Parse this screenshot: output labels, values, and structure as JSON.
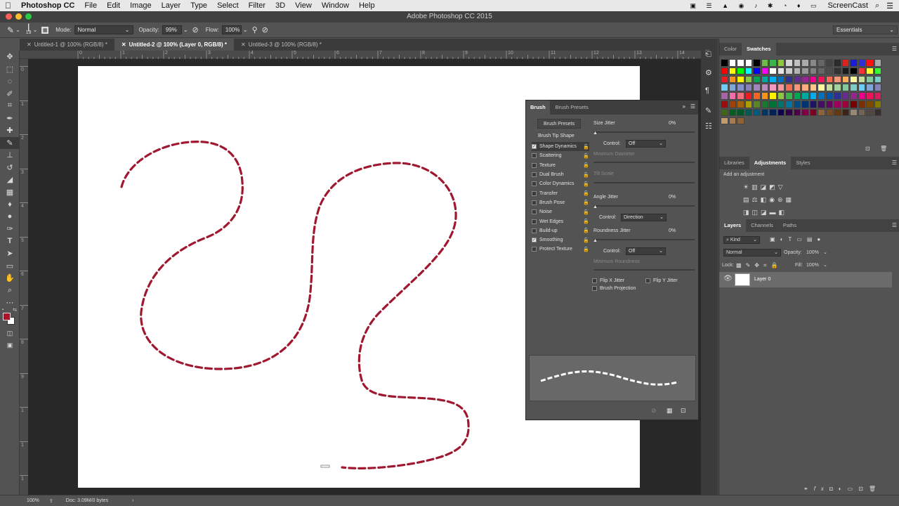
{
  "menubar": {
    "apple": "",
    "app": "Photoshop CC",
    "items": [
      "File",
      "Edit",
      "Image",
      "Layer",
      "Type",
      "Select",
      "Filter",
      "3D",
      "View",
      "Window",
      "Help"
    ],
    "right_app": "ScreenCast"
  },
  "window": {
    "title": "Adobe Photoshop CC 2015"
  },
  "options": {
    "brush_size": "19",
    "mode_label": "Mode:",
    "mode_value": "Normal",
    "opacity_label": "Opacity:",
    "opacity_value": "99%",
    "flow_label": "Flow:",
    "flow_value": "100%",
    "workspace": "Essentials"
  },
  "doc_tabs": [
    {
      "label": "Untitled-1 @ 100% (RGB/8) *",
      "active": false
    },
    {
      "label": "Untitled-2 @ 100% (Layer 0, RGB/8) *",
      "active": true
    },
    {
      "label": "Untitled-3 @ 100% (RGB/8) *",
      "active": false
    }
  ],
  "ruler_top": [
    "0",
    "1",
    "2",
    "3",
    "4",
    "5",
    "6",
    "7",
    "8",
    "9",
    "10",
    "11",
    "12",
    "13",
    "14",
    "15",
    "16"
  ],
  "ruler_left": [
    "0",
    "1",
    "2",
    "3",
    "4",
    "5",
    "6",
    "7",
    "8",
    "9",
    "1",
    "1",
    "1"
  ],
  "brush_panel": {
    "tabs": [
      "Brush",
      "Brush Presets"
    ],
    "presets_button": "Brush Presets",
    "tip_shape": "Brush Tip Shape",
    "items": [
      {
        "label": "Shape Dynamics",
        "checked": true,
        "selected": true
      },
      {
        "label": "Scattering",
        "checked": false
      },
      {
        "label": "Texture",
        "checked": false
      },
      {
        "label": "Dual Brush",
        "checked": false
      },
      {
        "label": "Color Dynamics",
        "checked": false
      },
      {
        "label": "Transfer",
        "checked": false
      },
      {
        "label": "Brush Pose",
        "checked": false
      },
      {
        "label": "Noise",
        "checked": false
      },
      {
        "label": "Wet Edges",
        "checked": false
      },
      {
        "label": "Build-up",
        "checked": false
      },
      {
        "label": "Smoothing",
        "checked": true
      },
      {
        "label": "Protect Texture",
        "checked": false
      }
    ],
    "size_jitter_label": "Size Jitter",
    "size_jitter_value": "0%",
    "control1_label": "Control:",
    "control1_value": "Off",
    "min_diameter": "Minimum Diameter",
    "tilt_scale": "Tilt Scale",
    "angle_jitter_label": "Angle Jitter",
    "angle_jitter_value": "0%",
    "control2_label": "Control:",
    "control2_value": "Direction",
    "roundness_label": "Roundness Jitter",
    "roundness_value": "0%",
    "control3_label": "Control:",
    "control3_value": "Off",
    "min_roundness": "Minimum Roundness",
    "flip_x": "Flip X Jitter",
    "flip_y": "Flip Y Jitter",
    "projection": "Brush Projection"
  },
  "color_panel": {
    "tabs": [
      "Color",
      "Swatches"
    ],
    "active": "Swatches"
  },
  "adjust_panel": {
    "tabs": [
      "Libraries",
      "Adjustments",
      "Styles"
    ],
    "active": "Adjustments",
    "hint": "Add an adjustment"
  },
  "layers_panel": {
    "tabs": [
      "Layers",
      "Channels",
      "Paths"
    ],
    "filter": "Kind",
    "blend": "Normal",
    "opacity_label": "Opacity:",
    "opacity_value": "100%",
    "lock_label": "Lock:",
    "fill_label": "Fill:",
    "fill_value": "100%",
    "layer_name": "Layer 0"
  },
  "status": {
    "zoom": "100%",
    "doc": "Doc: 3.09M/0 bytes"
  },
  "colors": {
    "stroke": "#a01830",
    "foreground": "#b0102a"
  }
}
